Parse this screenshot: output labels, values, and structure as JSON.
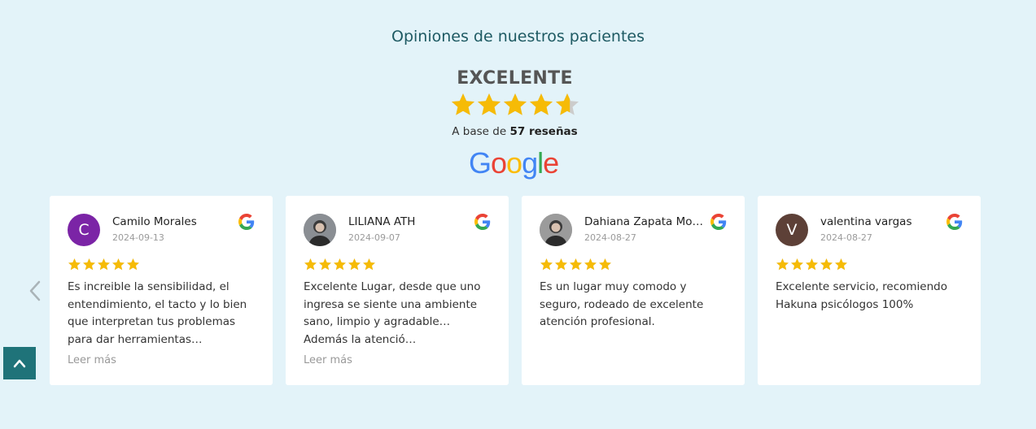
{
  "section_title": "Opiniones de nuestros pacientes",
  "summary": {
    "rating_word": "EXCELENTE",
    "rating_value": 4.6,
    "rating_max": 5,
    "based_prefix": "A base de",
    "based_count": "57 reseñas",
    "brand": "Google"
  },
  "colors": {
    "background": "#e3f3f9",
    "title": "#1e5a63",
    "star": "#f6bb06",
    "star_empty": "#cccccc",
    "accent": "#1f7379",
    "google_blue": "#4285F4",
    "google_red": "#EA4335",
    "google_yellow": "#FBBC05",
    "google_green": "#34A853"
  },
  "controls": {
    "prev_icon": "chevron-left-icon",
    "back_to_top_icon": "chevron-up-icon"
  },
  "reviews": [
    {
      "name": "Camilo Morales",
      "date": "2024-09-13",
      "stars": 5,
      "avatar_letter": "C",
      "avatar_color": "#7b24a6",
      "text": "Es increible la sensibilidad, el entendimiento, el tacto y lo bien que interpretan tus problemas para dar herramientas…",
      "read_more": "Leer más"
    },
    {
      "name": "LILIANA ATH",
      "date": "2024-09-07",
      "stars": 5,
      "avatar_letter": "",
      "avatar_color": "#8a8e93",
      "text": "Excelente Lugar, desde que uno ingresa se siente una ambiente sano, limpio y agradable…Además la atenció…",
      "read_more": "Leer más"
    },
    {
      "name": "Dahiana Zapata Mo…",
      "date": "2024-08-27",
      "stars": 5,
      "avatar_letter": "",
      "avatar_color": "#9b9b9b",
      "text": "Es un lugar muy comodo y seguro, rodeado de excelente atención profesional.",
      "read_more": ""
    },
    {
      "name": "valentina vargas",
      "date": "2024-08-27",
      "stars": 5,
      "avatar_letter": "V",
      "avatar_color": "#5d4037",
      "text": "Excelente servicio, recomiendo Hakuna psicólogos 100%",
      "read_more": ""
    }
  ]
}
